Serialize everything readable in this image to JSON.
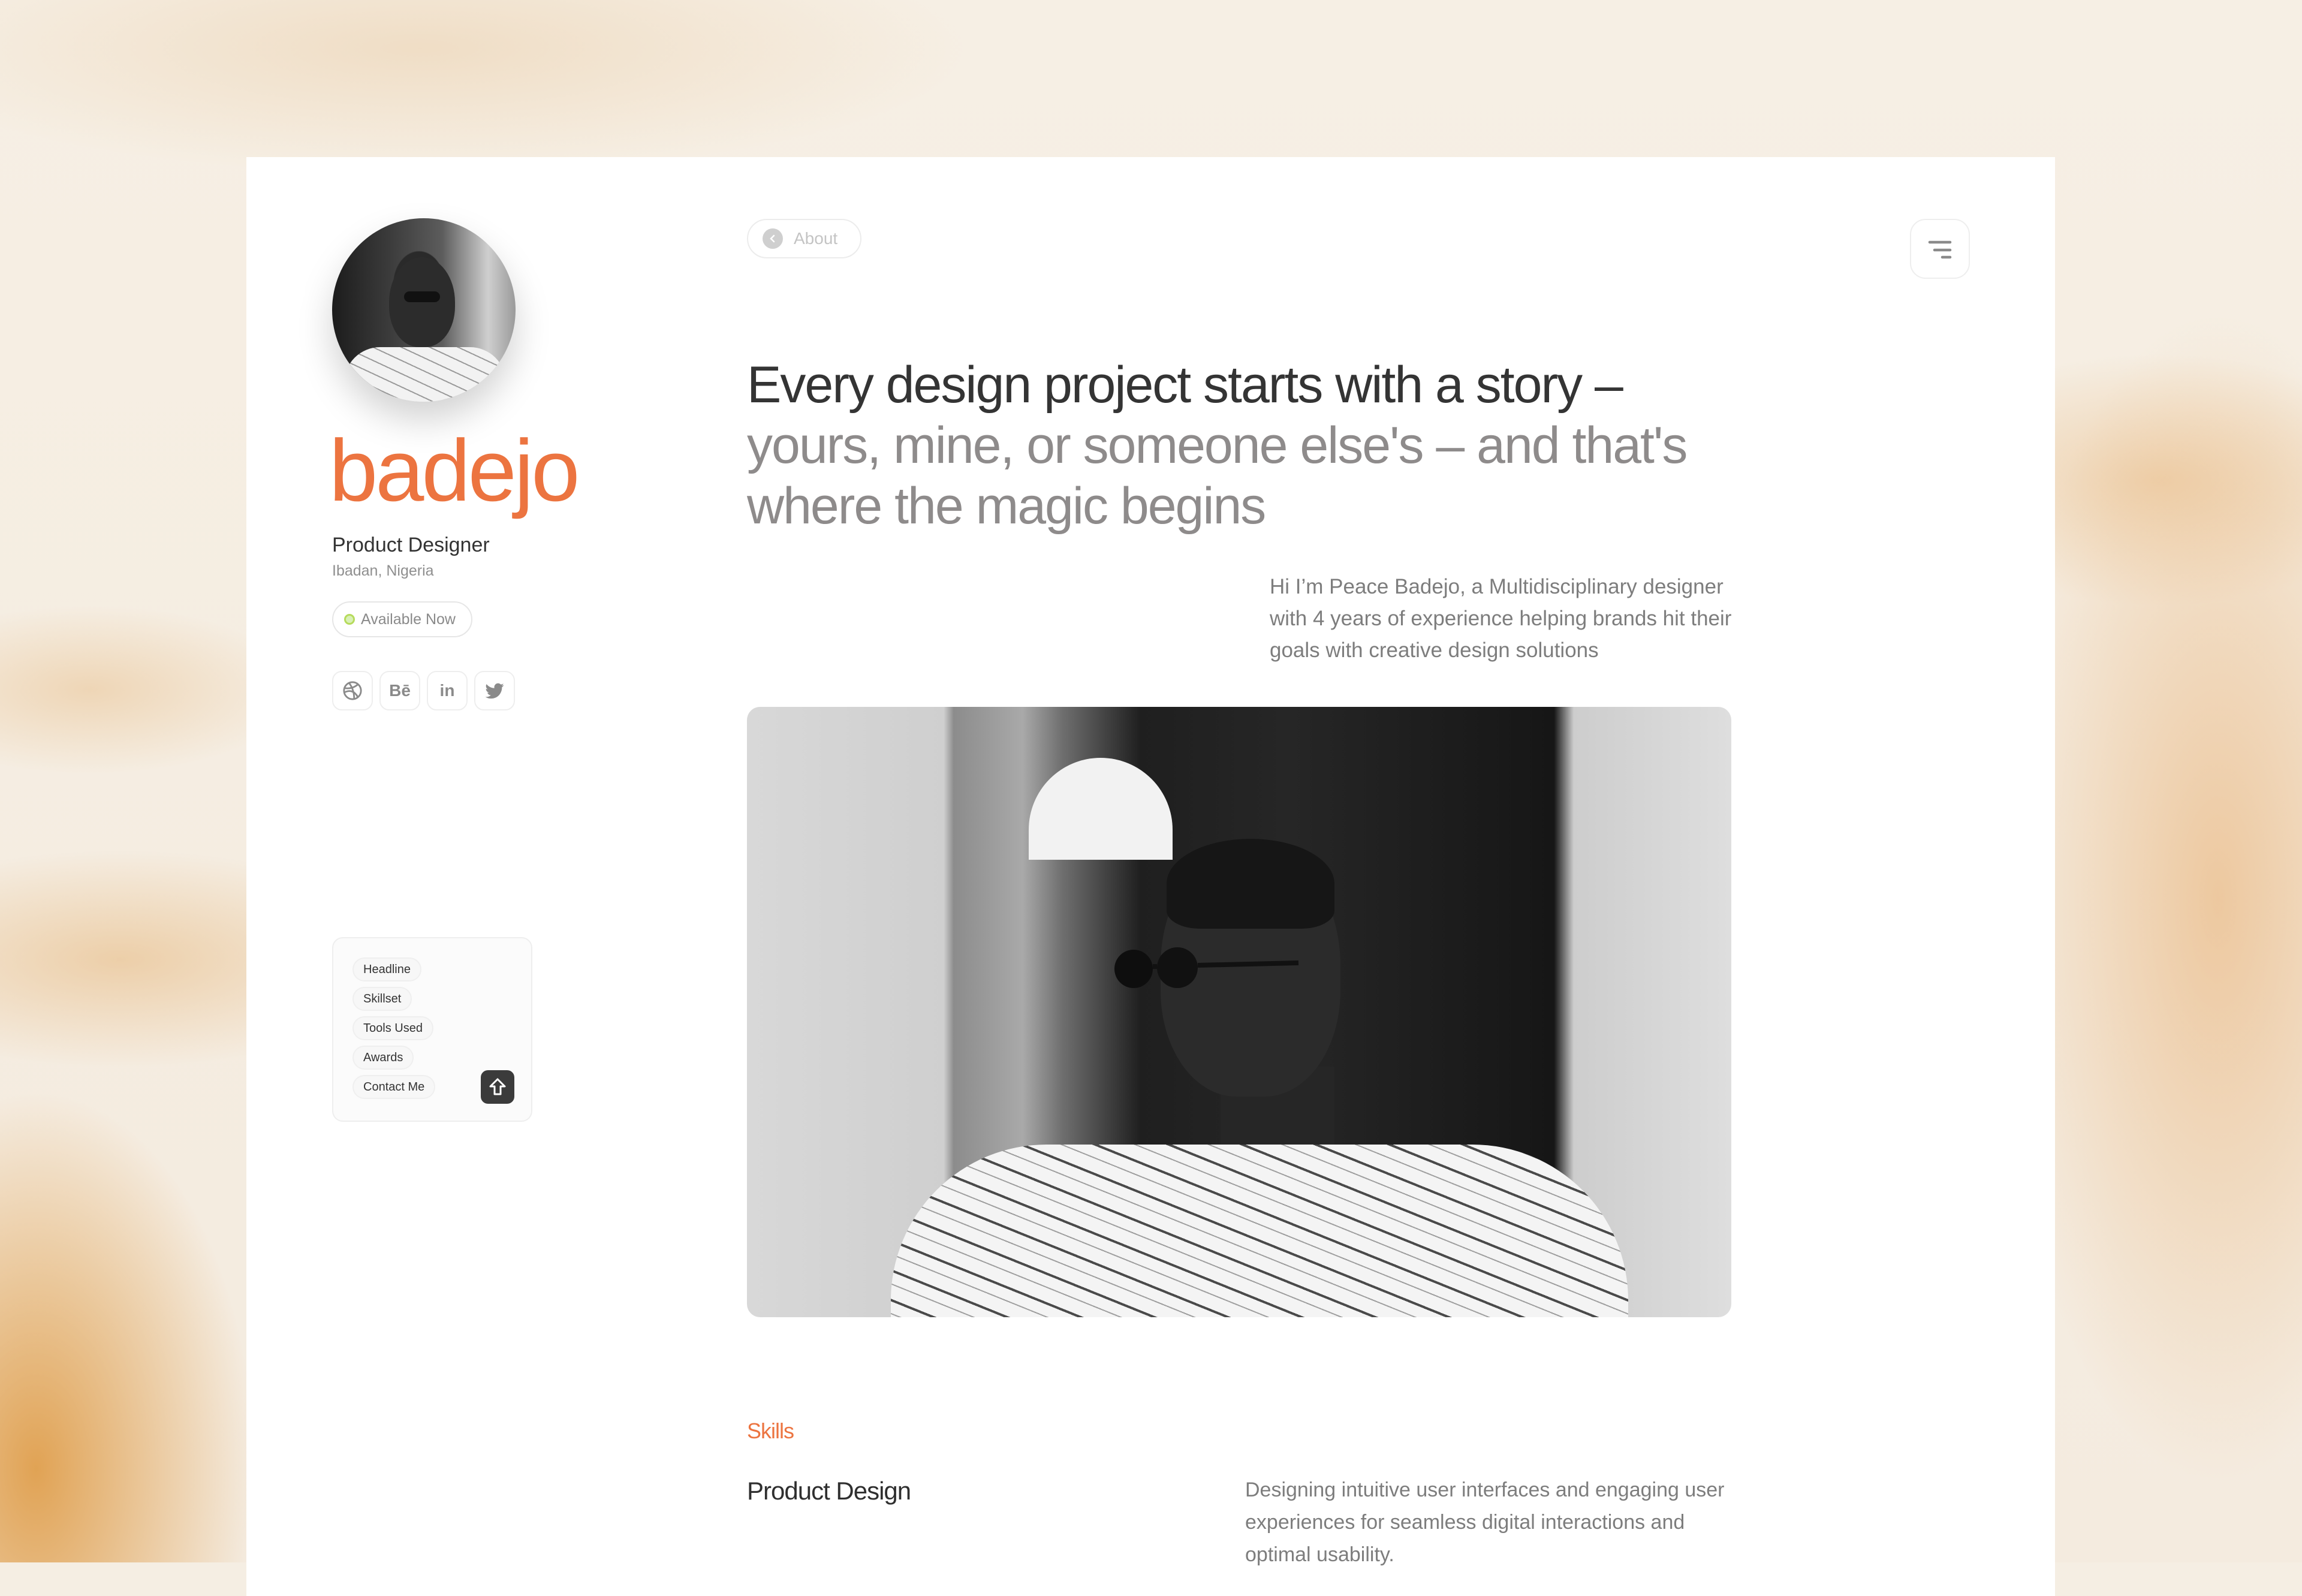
{
  "sidebar": {
    "brand_name": "badejo",
    "role": "Product Designer",
    "location": "Ibadan, Nigeria",
    "status": "Available Now",
    "socials": [
      {
        "name": "dribbble",
        "icon": "dribbble-icon",
        "label": ""
      },
      {
        "name": "behance",
        "icon": "behance-icon",
        "label": "Bē"
      },
      {
        "name": "linkedin",
        "icon": "linkedin-icon",
        "label": "in"
      },
      {
        "name": "twitter",
        "icon": "twitter-icon",
        "label": ""
      }
    ],
    "toc": {
      "items": [
        "Headline",
        "Skillset",
        "Tools Used",
        "Awards",
        "Contact Me"
      ],
      "scroll_top_icon": "arrow-up-icon"
    }
  },
  "header": {
    "back_label": "About",
    "menu_icon": "menu-icon"
  },
  "main": {
    "headline_dark": "Every design project starts with a story –",
    "headline_light": "yours, mine, or someone else's – and that's where the magic begins",
    "intro": "Hi I’m Peace Badejo, a Multidisciplinary designer with 4 years of experience helping brands hit their goals with creative design solutions",
    "hero_image_alt": "Black and white portrait of man in round sunglasses and patterned shirt",
    "skills": {
      "section_label": "Skills",
      "items": [
        {
          "title": "Product Design",
          "description": "Designing intuitive user interfaces and engaging user experiences for seamless digital interactions and optimal usability."
        }
      ]
    }
  },
  "colors": {
    "accent": "#ec7440",
    "status_dot": "#b6db5c",
    "text_dark": "#343434",
    "text_muted": "#8e8b8b"
  }
}
